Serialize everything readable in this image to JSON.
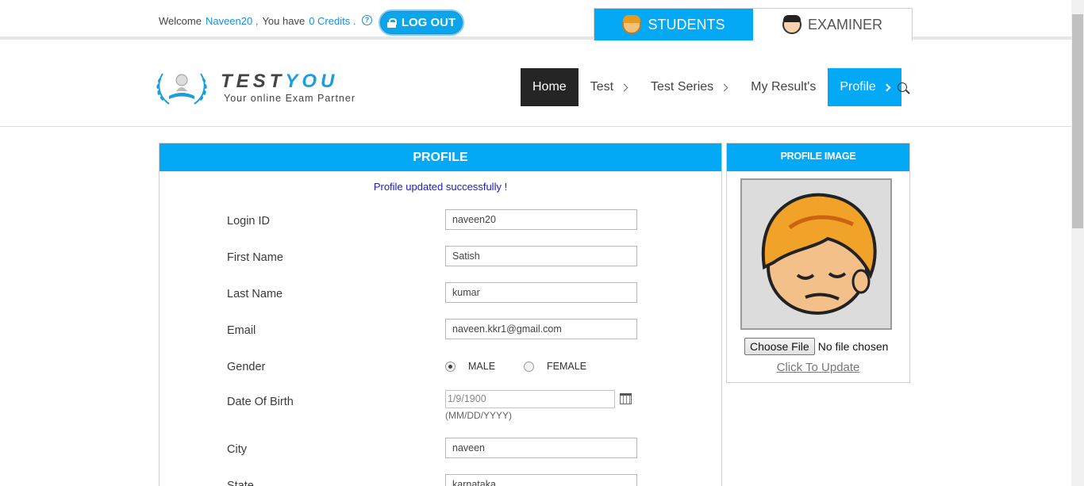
{
  "top_bar": {
    "welcome_text": "Welcome",
    "username": "Naveen20 ,",
    "you_have": "You have",
    "credits": "0 Credits .",
    "logout_label": "LOG OUT"
  },
  "role_tabs": [
    {
      "label": "STUDENTS",
      "icon": "student-face-icon",
      "active": true
    },
    {
      "label": "EXAMINER",
      "icon": "examiner-face-icon",
      "active": false
    }
  ],
  "logo": {
    "title_part1": "TEST",
    "title_part2": "YOU",
    "tagline": "Your online Exam Partner"
  },
  "nav": [
    {
      "label": "Home"
    },
    {
      "label": "Test"
    },
    {
      "label": "Test Series"
    },
    {
      "label": "My Result's"
    },
    {
      "label": "Profile"
    }
  ],
  "profile": {
    "heading": "PROFILE",
    "success_message": "Profile updated successfully !",
    "fields": {
      "login_id": {
        "label": "Login ID",
        "value": "naveen20"
      },
      "first_name": {
        "label": "First Name",
        "value": "Satish"
      },
      "last_name": {
        "label": "Last Name",
        "value": "kumar"
      },
      "email": {
        "label": "Email",
        "value": "naveen.kkr1@gmail.com"
      },
      "gender": {
        "label": "Gender",
        "options": [
          "MALE",
          "FEMALE"
        ],
        "selected": "MALE"
      },
      "dob": {
        "label": "Date Of Birth",
        "value": "1/9/1900",
        "hint": "(MM/DD/YYYY)"
      },
      "city": {
        "label": "City",
        "value": "naveen"
      },
      "state": {
        "label": "State",
        "value": "karnataka"
      }
    }
  },
  "profile_image": {
    "heading": "PROFILE IMAGE",
    "choose_file_label": "Choose File",
    "no_file_text": "No file chosen",
    "update_link": "Click To Update"
  },
  "colors": {
    "accent": "#03a9f4",
    "dark_nav": "#252525",
    "link": "#1a8fd8"
  }
}
